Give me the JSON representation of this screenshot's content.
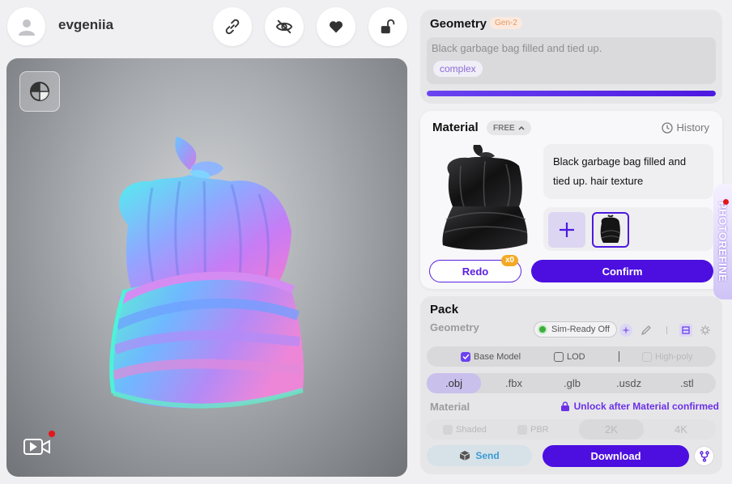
{
  "header": {
    "username": "evgeniia",
    "buttons": [
      "link-icon",
      "eye-off-icon",
      "heart-icon",
      "unlock-icon"
    ]
  },
  "viewport": {
    "model": "normal-map garbage bag",
    "background": "#9ea1a5"
  },
  "geometry": {
    "title": "Geometry",
    "badge": "Gen-2",
    "prompt": "Black garbage bag filled and tied up.",
    "tag": "complex",
    "progress": 1.0
  },
  "material": {
    "title": "Material",
    "badge": "FREE",
    "history_label": "History",
    "prompt": "Black garbage bag filled and tied up. hair texture",
    "redo_label": "Redo",
    "redo_count": "x0",
    "confirm_label": "Confirm"
  },
  "photo_refine": {
    "label": "PHOTOREFINE"
  },
  "pack": {
    "title": "Pack",
    "geometry_label": "Geometry",
    "sim_ready_label": "Sim-Ready Off",
    "options": {
      "base_model": "Base Model",
      "lod": "LOD",
      "high_poly": "High-poly"
    },
    "formats": [
      ".obj",
      ".fbx",
      ".glb",
      ".usdz",
      ".stl"
    ],
    "selected_format": ".obj",
    "material_label": "Material",
    "unlock_notice": "Unlock after Material confirmed",
    "material_options": {
      "shaded": "Shaded",
      "pbr": "PBR",
      "res_2k": "2K",
      "res_4k": "4K"
    },
    "send_label": "Send",
    "download_label": "Download"
  },
  "colors": {
    "accent": "#4c0fe0",
    "accent_light": "#d6d3f5",
    "panel": "#e6e6e9"
  }
}
